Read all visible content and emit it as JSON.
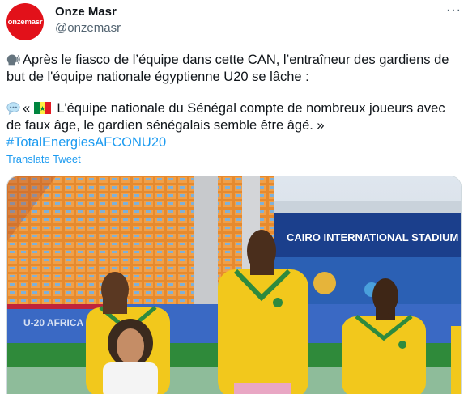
{
  "author": {
    "avatar_text": "onzemasr",
    "display_name": "Onze Masr",
    "handle": "@onzemasr"
  },
  "icons": {
    "more": "more-options-icon",
    "speaker": "speaking-head-icon",
    "speech": "speech-balloon-icon",
    "flag": "senegal-flag-icon"
  },
  "tweet": {
    "line1": "Après le fiasco de l’équipe dans cette CAN, l’entraîneur des gardiens de but de l'équipe nationale égyptienne U20 se lâche :",
    "quote": "« 🇸🇳 L'équipe nationale du Sénégal compte de nombreux joueurs avec de faux âge, le gardien sénégalais semble être âgé. »",
    "quote_before": "« ",
    "quote_after": " L'équipe nationale du Sénégal compte de nombreux joueurs avec de faux âge, le gardien sénégalais semble être âgé. »",
    "hashtag": "#TotalEnergiesAFCONU20"
  },
  "translate_label": "Translate Tweet",
  "media": {
    "banner_text": "CAIRO INTERNATIONAL STADIUM",
    "board_text": "U-20 AFRICA",
    "colors": {
      "jersey": "#f2c81c",
      "jersey_trim": "#2e8a3e",
      "pitch": "#2f8a3a",
      "stand": "#e68a2e",
      "banner": "#1b3f8c",
      "brand_red": "#e2111a",
      "link": "#1d9bf0"
    }
  }
}
